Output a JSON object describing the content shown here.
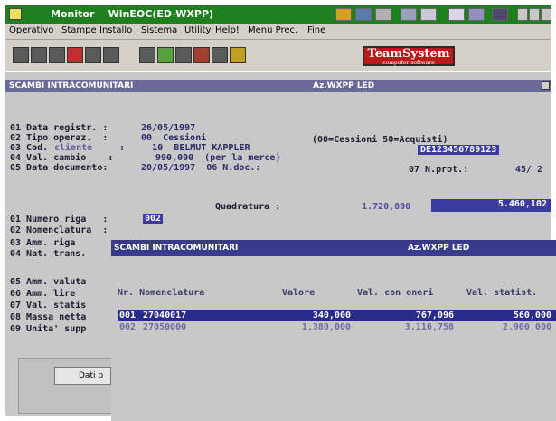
{
  "window": {
    "title": "Monitor    WinEOC(ED-WXPP)"
  },
  "menu": [
    "Operativo",
    "Stampe",
    "Installo",
    "Sistema",
    "Utility",
    "Help!",
    "Menu Prec.",
    "Fine"
  ],
  "toolbar": {
    "brand_name": "TeamSystem",
    "brand_tagline": "computer software"
  },
  "main": {
    "header_left": "SCAMBI INTRACOMUNITARI",
    "header_right": "Az.WXPP LED",
    "fields": {
      "data_registr_label": "01 Data registr. :",
      "data_registr_value": "26/05/1997",
      "tipo_operaz_label": "02 Tipo operaz.  :",
      "tipo_operaz_value": "00  Cessioni",
      "tipo_operaz_hint": "(00=Cessioni 50=Acquisti)",
      "cod_cliente_label": "03 Cod.",
      "cod_cliente_label2": "cliente",
      "cod_cliente_value": ":     10  BELMUT KAPPLER",
      "cod_cliente_piva": "DE123456789123",
      "val_cambio_label": "04 Val. cambio    :",
      "val_cambio_value": "990,000  (per la merce)",
      "data_documento_label": "05 Data documento:",
      "data_documento_value": "20/05/1997  06 N.doc.:",
      "nprot_label": "07 N.prot.:",
      "nprot_value": "45/ 2"
    },
    "quadratura": {
      "label": "Quadratura :",
      "value1": "1.720,000",
      "value2": "5.460,102"
    },
    "row_fields": [
      {
        "label": "01 Numero riga   :",
        "value": "002"
      },
      {
        "label": "02 Nomenclatura  :",
        "value": ""
      },
      {
        "label": "03 Amm. riga",
        "value": ""
      },
      {
        "label": "04 Nat. trans.",
        "value": ""
      },
      {
        "label": "05 Amm. valuta",
        "value": ""
      },
      {
        "label": "06 Amm. lire",
        "value": ""
      },
      {
        "label": "07 Val. statis",
        "value": ""
      },
      {
        "label": "08 Massa netta",
        "value": ""
      },
      {
        "label": "09 Unita' supp",
        "value": ""
      }
    ]
  },
  "popup": {
    "header_left": "SCAMBI INTRACOMUNITARI",
    "header_right": "Az.WXPP LED",
    "columns": [
      "Nr. Nomenclatura",
      "Valore",
      "Val. con oneri",
      "Val. statist."
    ],
    "rows": [
      {
        "nr": "001",
        "nomenclatura": "27040017",
        "valore": "340,000",
        "val_oneri": "767,096",
        "val_statist": "560,000"
      },
      {
        "nr": "002",
        "nomenclatura": "27050000",
        "valore": "1.380,000",
        "val_oneri": "3.116,758",
        "val_statist": "2.900,000"
      }
    ]
  },
  "bottom": {
    "button_label": "Dati p"
  },
  "colors": {
    "title_green": "#1f7f1f",
    "panel_gray": "#c8c8c8",
    "header_blue": "#3a3a8a",
    "highlight_blue": "#3a3aa0",
    "brand_red": "#b81a18"
  }
}
